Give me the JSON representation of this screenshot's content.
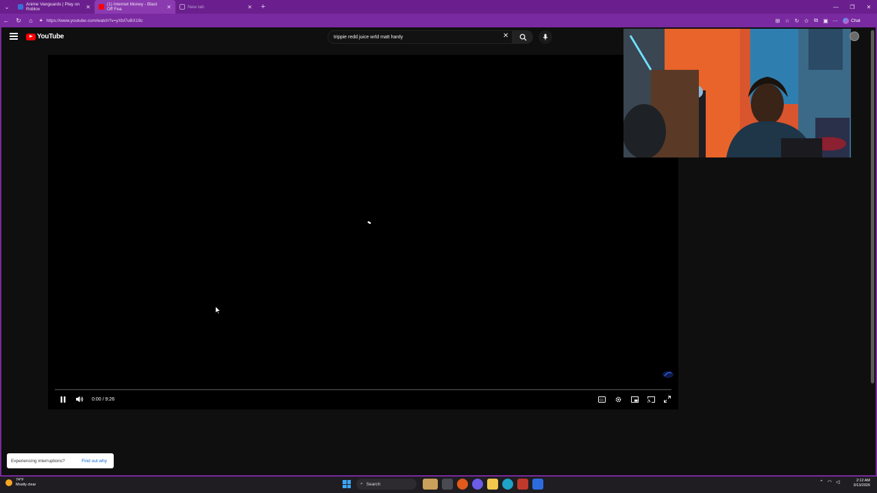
{
  "browser": {
    "tabs": [
      {
        "title": "Anime Vanguards | Play on Roblox",
        "favicon": "roblox-icon",
        "active": false
      },
      {
        "title": "(1) Internet Money - Blast Off Fea",
        "favicon": "youtube-icon",
        "active": true
      },
      {
        "title": "New tab",
        "favicon": "newtab-icon",
        "active": false
      }
    ],
    "url": "https://www.youtube.com/watch?v=yXbl7uBX19c",
    "chat_label": "Chat",
    "accent_color": "#7a2aa0"
  },
  "youtube": {
    "logo_text": "YouTube",
    "search_query": "trippie redd juice wrld matt hardy"
  },
  "player": {
    "time_display": "0:00 / 9:26",
    "progress_fraction": 0.0,
    "state": "playing"
  },
  "toast": {
    "message": "Experiencing interruptions?",
    "link": "Find out why"
  },
  "taskbar": {
    "weather_temp": "74°F",
    "weather_desc": "Mostly clear",
    "search_label": "Search",
    "time": "2:12 AM",
    "date": "3/13/2026"
  }
}
